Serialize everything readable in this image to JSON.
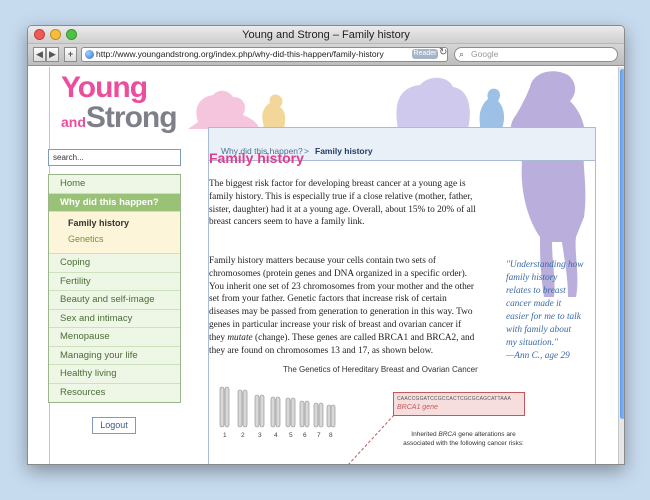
{
  "browser": {
    "title": "Young and Strong – Family history",
    "url": "http://www.youngandstrong.org/index.php/why-did-this-happen/family-history",
    "reader_label": "Reader",
    "search_placeholder": "Google"
  },
  "logo": {
    "line1": "Young",
    "line2a": "and",
    "line2b": "Strong"
  },
  "search": {
    "value": "search..."
  },
  "nav": {
    "items_top": [
      "Home"
    ],
    "active": "Why did this happen?",
    "subitems": [
      "Family history",
      "Genetics"
    ],
    "items_bottom": [
      "Coping",
      "Fertility",
      "Beauty and self-image",
      "Sex and intimacy",
      "Menopause",
      "Managing your life",
      "Healthy living",
      "Resources"
    ]
  },
  "logout_label": "Logout",
  "breadcrumb": {
    "parent": "Why did this happen?",
    "separator": ">",
    "current": "Family history"
  },
  "page": {
    "title": "Family history",
    "para1": "The biggest risk factor for developing breast cancer at a young age is family history. This is especially true if a close relative (mother, father, sister, daughter) had it at a young age. Overall, about 15% to 20% of all breast cancers seem to have a family link.",
    "para2_a": "Family history matters because your cells contain two sets of chromosomes (protein genes and DNA organized in a specific order). You inherit one set of 23 chromosomes from your mother and the other set from your father. Genetic factors that increase risk of certain diseases may be passed from generation to generation in this way. Two genes in particular increase your risk of breast and ovarian cancer if they ",
    "para2_em": "mutate",
    "para2_b": " (change). These genes are called BRCA1 and BRCA2, and they are found on chromosomes 13 and 17, as shown below.",
    "diagram_title": "The Genetics of Hereditary Breast and Ovarian Cancer"
  },
  "quote": {
    "text": "\"Understanding how family history relates to breast cancer made it easier for me to talk with family about my situation.\"",
    "attribution": "—Ann C., age 29"
  },
  "diagram": {
    "chromosome_numbers": [
      "1",
      "2",
      "3",
      "4",
      "5",
      "6",
      "7",
      "8"
    ],
    "gene_sequence": "CAACCGGATCCGCCACTCGCGCAGCATTAAA",
    "gene_label": "BRCA1 gene",
    "note_a": "Inherited ",
    "note_em": "BRCA",
    "note_b": " gene alterations are associated with the following cancer risks:"
  }
}
